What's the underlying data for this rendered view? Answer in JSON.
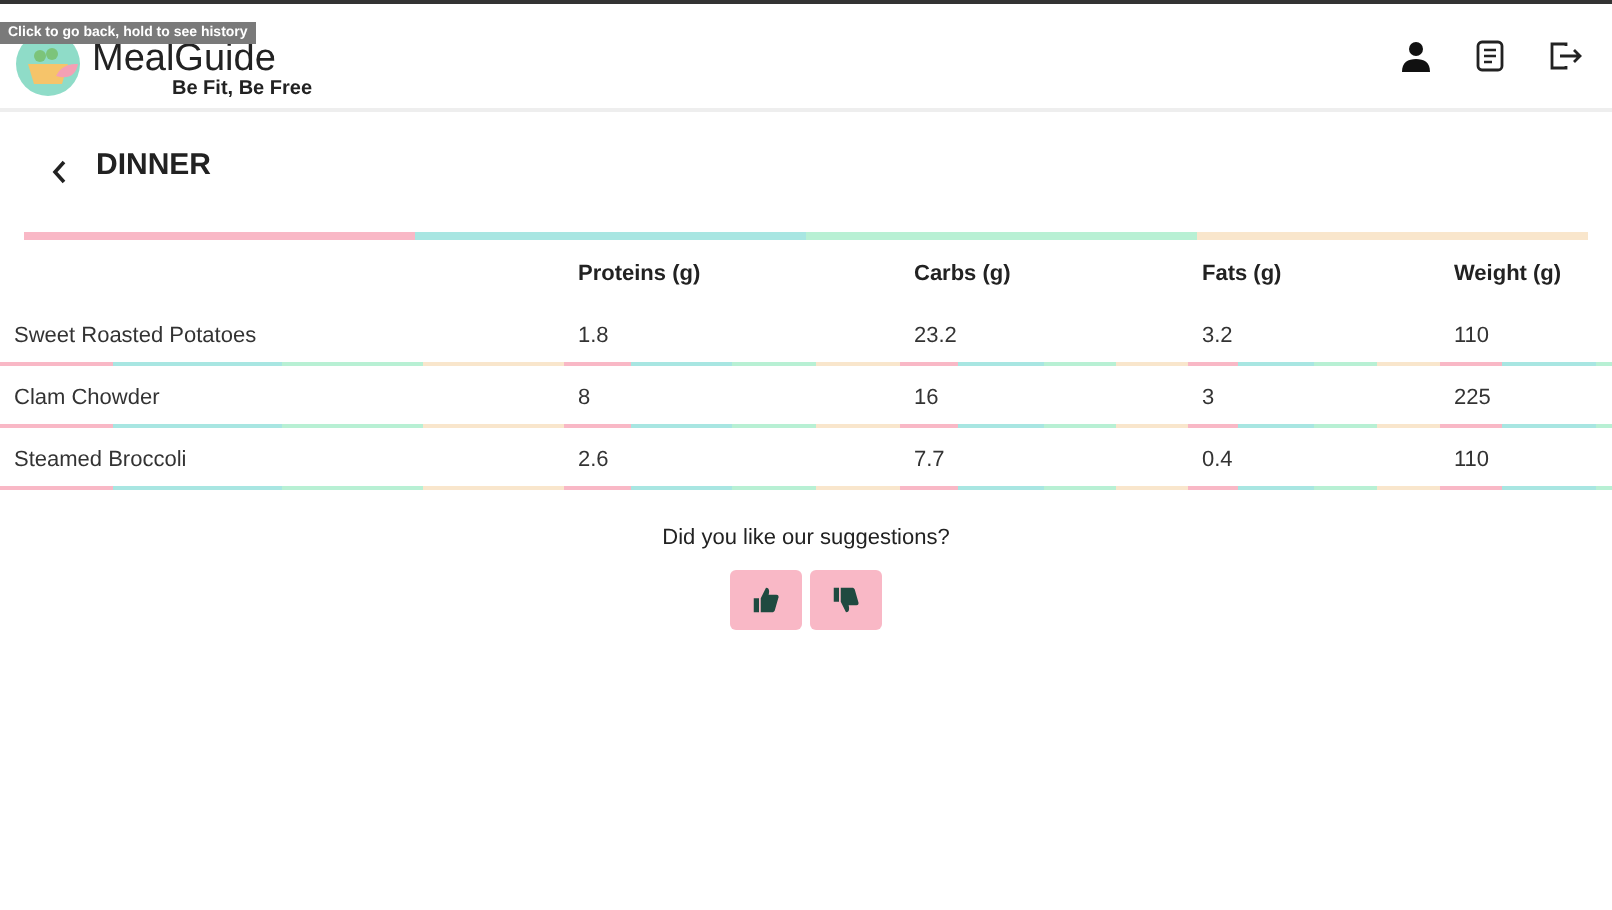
{
  "tooltip": "Click to go back, hold to see history",
  "header": {
    "title": "MealGuide",
    "tagline": "Be Fit, Be Free"
  },
  "page": {
    "title": "DINNER"
  },
  "table": {
    "columns": [
      "",
      "Proteins (g)",
      "Carbs (g)",
      "Fats (g)",
      "Weight (g)"
    ],
    "rows": [
      [
        "Sweet Roasted Potatoes",
        "1.8",
        "23.2",
        "3.2",
        "110"
      ],
      [
        "Clam Chowder",
        "8",
        "16",
        "3",
        "225"
      ],
      [
        "Steamed Broccoli",
        "2.6",
        "7.7",
        "0.4",
        "110"
      ]
    ]
  },
  "feedback": {
    "question": "Did you like our suggestions?"
  }
}
